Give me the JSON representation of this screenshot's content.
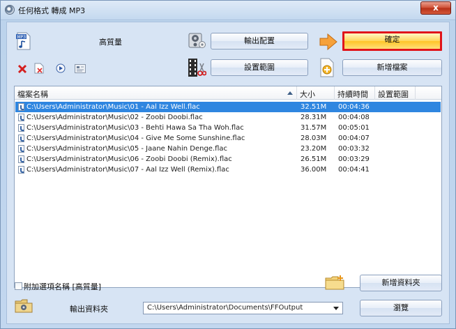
{
  "window": {
    "title": "任何格式 轉成 MP3",
    "close_label": "x"
  },
  "toolbar": {
    "quality_label": "高質量",
    "output_config_button": "輸出配置",
    "ok_button": "確定",
    "set_range_button": "設置範圍",
    "add_file_button": "新增檔案",
    "mp3_icon_text": "MP3"
  },
  "table": {
    "headers": {
      "name": "檔案名稱",
      "size": "大小",
      "duration": "持續時間",
      "range": "設置範圍"
    },
    "rows": [
      {
        "name": "C:\\Users\\Administrator\\Music\\01 - Aal Izz Well.flac",
        "size": "32.51M",
        "duration": "00:04:36",
        "range": ""
      },
      {
        "name": "C:\\Users\\Administrator\\Music\\02 - Zoobi Doobi.flac",
        "size": "28.31M",
        "duration": "00:04:08",
        "range": ""
      },
      {
        "name": "C:\\Users\\Administrator\\Music\\03 - Behti Hawa Sa Tha Woh.flac",
        "size": "31.57M",
        "duration": "00:05:01",
        "range": ""
      },
      {
        "name": "C:\\Users\\Administrator\\Music\\04 - Give Me Some Sunshine.flac",
        "size": "28.03M",
        "duration": "00:04:07",
        "range": ""
      },
      {
        "name": "C:\\Users\\Administrator\\Music\\05 - Jaane Nahin Denge.flac",
        "size": "23.20M",
        "duration": "00:03:32",
        "range": ""
      },
      {
        "name": "C:\\Users\\Administrator\\Music\\06 - Zoobi Doobi (Remix).flac",
        "size": "26.51M",
        "duration": "00:03:29",
        "range": ""
      },
      {
        "name": "C:\\Users\\Administrator\\Music\\07 - Aal Izz Well (Remix).flac",
        "size": "36.00M",
        "duration": "00:04:41",
        "range": ""
      }
    ],
    "selected_index": 0
  },
  "bottom": {
    "append_option_label": "附加選項名稱 [高質量]",
    "append_option_checked": false,
    "new_folder_button": "新增資料夾",
    "output_folder_label": "輸出資料夾",
    "output_folder_value": "C:\\Users\\Administrator\\Documents\\FFOutput",
    "browse_button": "瀏覽"
  },
  "colors": {
    "highlight_border": "#e0141a",
    "selection": "#2f86e0"
  }
}
